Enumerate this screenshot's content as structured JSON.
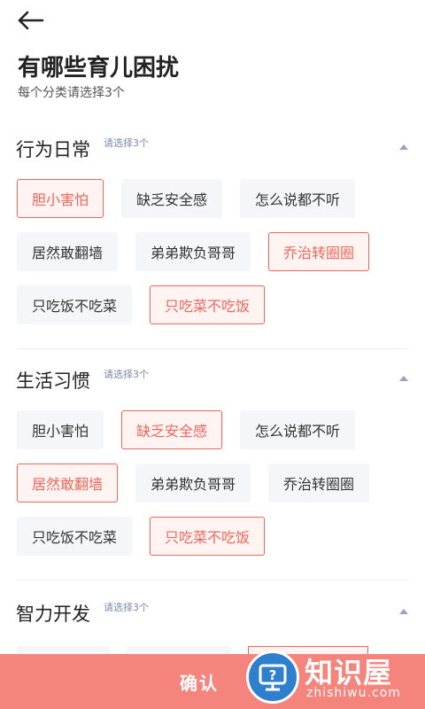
{
  "header": {
    "title": "有哪些育儿困扰",
    "subtitle": "每个分类请选择3个"
  },
  "sections": [
    {
      "title": "行为日常",
      "hint": "请选择3个",
      "tags": [
        {
          "label": "胆小害怕",
          "selected": true
        },
        {
          "label": "缺乏安全感",
          "selected": false
        },
        {
          "label": "怎么说都不听",
          "selected": false
        },
        {
          "label": "居然敢翻墙",
          "selected": false
        },
        {
          "label": "弟弟欺负哥哥",
          "selected": false
        },
        {
          "label": "乔治转圈圈",
          "selected": true
        },
        {
          "label": "只吃饭不吃菜",
          "selected": false
        },
        {
          "label": "只吃菜不吃饭",
          "selected": true
        }
      ]
    },
    {
      "title": "生活习惯",
      "hint": "请选择3个",
      "tags": [
        {
          "label": "胆小害怕",
          "selected": false
        },
        {
          "label": "缺乏安全感",
          "selected": true
        },
        {
          "label": "怎么说都不听",
          "selected": false
        },
        {
          "label": "居然敢翻墙",
          "selected": true
        },
        {
          "label": "弟弟欺负哥哥",
          "selected": false
        },
        {
          "label": "乔治转圈圈",
          "selected": false
        },
        {
          "label": "只吃饭不吃菜",
          "selected": false
        },
        {
          "label": "只吃菜不吃饭",
          "selected": true
        }
      ]
    },
    {
      "title": "智力开发",
      "hint": "请选择3个",
      "tags": []
    }
  ],
  "footer": {
    "confirm_label": "确认"
  },
  "watermark": {
    "text": "知识屋",
    "sub": "zhishiwu.com"
  },
  "colors": {
    "accent": "#f0665a",
    "footer_bg": "#f5847c",
    "tag_bg": "#f5f6fa"
  }
}
